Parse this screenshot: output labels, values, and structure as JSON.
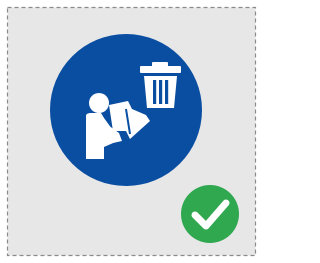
{
  "tile": {
    "background_color": "#e7e7e8",
    "border_color": "#8a8a8a",
    "border_style": "dashed"
  },
  "icon": {
    "name": "read-manual-dispose-icon",
    "disc_color": "#0a4ea2",
    "glyph_color": "#ffffff",
    "depicts": [
      "person-reading-icon",
      "trash-can-icon"
    ]
  },
  "badge": {
    "name": "checkmark-icon",
    "disc_color": "#2fa84f",
    "glyph_color": "#ffffff"
  }
}
